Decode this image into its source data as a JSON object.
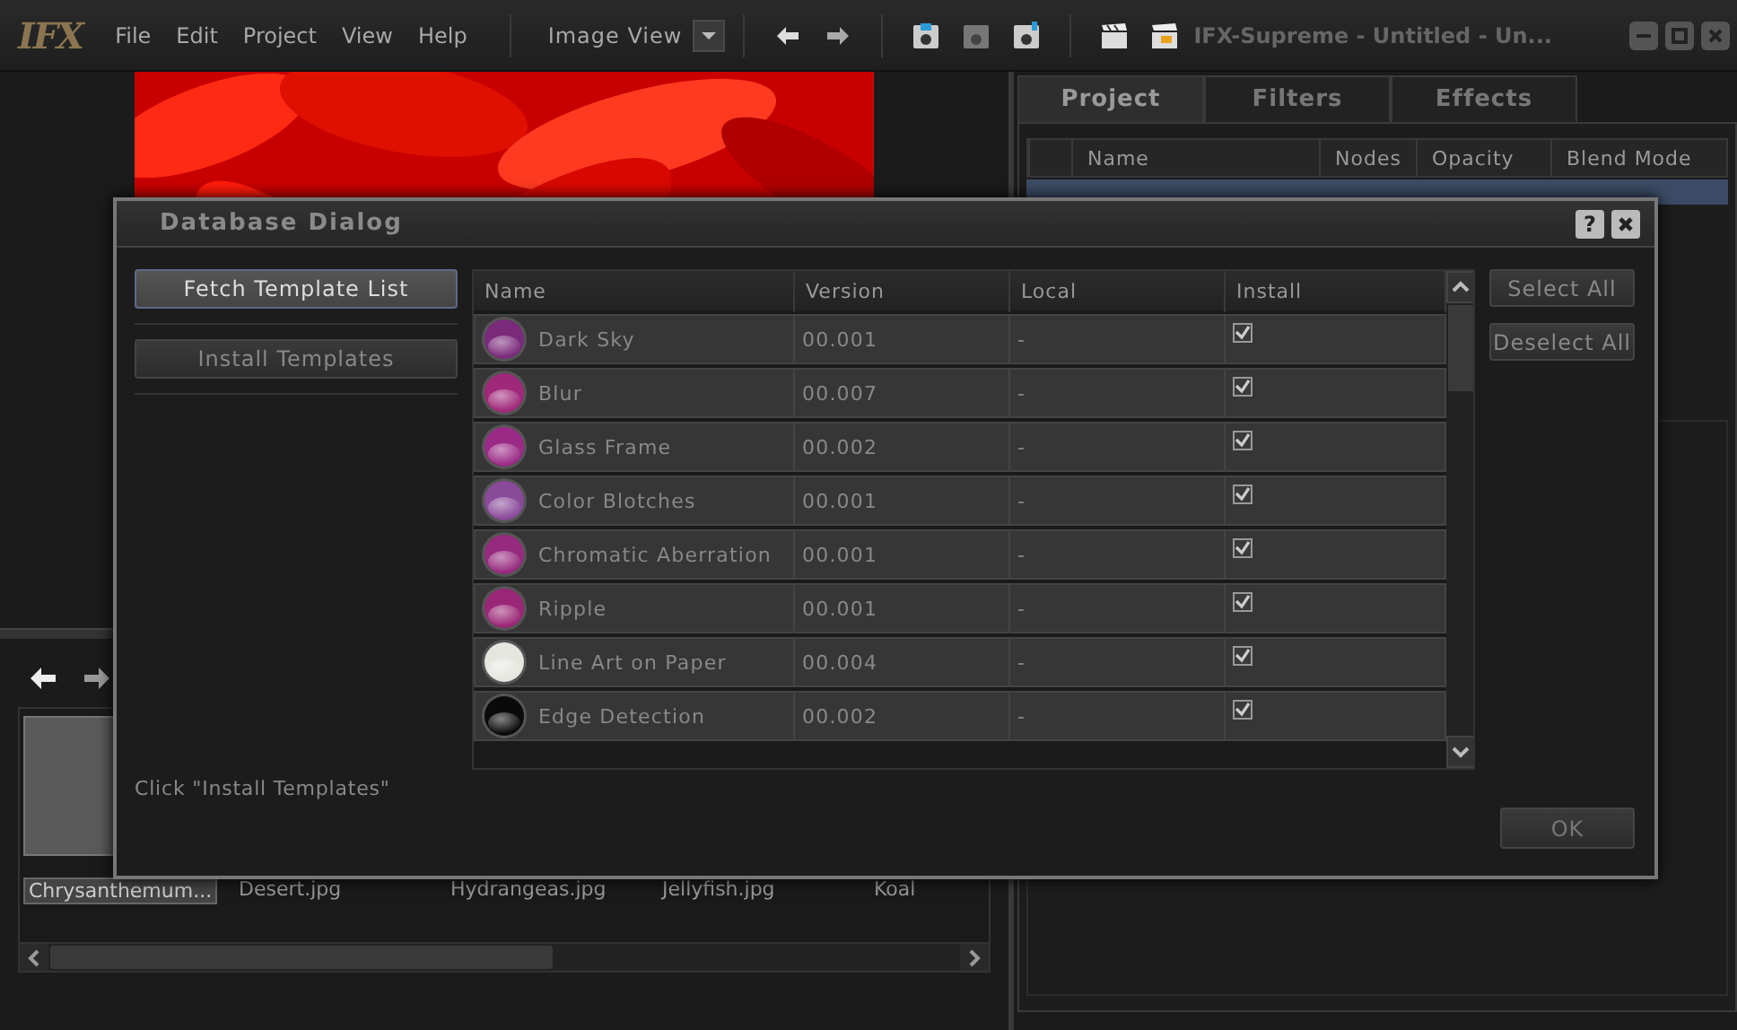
{
  "menubar": {
    "logo": "IFX",
    "menus": [
      "File",
      "Edit",
      "Project",
      "View",
      "Help"
    ],
    "view_select": "Image View",
    "title": "IFX-Supreme - Untitled - Un..."
  },
  "browser": {
    "thumbnails": [
      {
        "label": "Chrysanthemum...",
        "selected": true
      },
      {
        "label": "Desert.jpg",
        "selected": false
      },
      {
        "label": "Hydrangeas.jpg",
        "selected": false
      },
      {
        "label": "Jellyfish.jpg",
        "selected": false
      },
      {
        "label": "Koal",
        "selected": false
      }
    ]
  },
  "panel": {
    "tabs": [
      {
        "label": "Project",
        "selected": true
      },
      {
        "label": "Filters",
        "selected": false
      },
      {
        "label": "Effects",
        "selected": false
      }
    ],
    "columns": [
      "Name",
      "Nodes",
      "Opacity",
      "Blend Mode"
    ]
  },
  "dialog": {
    "title": "Database Dialog",
    "help": "?",
    "left_buttons": [
      {
        "label": "Fetch Template List",
        "focused": true
      },
      {
        "label": "Install Templates",
        "focused": false
      }
    ],
    "columns": [
      "Name",
      "Version",
      "Local",
      "Install"
    ],
    "rows": [
      {
        "name": "Dark Sky",
        "version": "00.001",
        "local": "-",
        "install": true,
        "color": "#7a2a7a"
      },
      {
        "name": "Blur",
        "version": "00.007",
        "local": "-",
        "install": true,
        "color": "#a0287a"
      },
      {
        "name": "Glass Frame",
        "version": "00.002",
        "local": "-",
        "install": true,
        "color": "#9a2a86"
      },
      {
        "name": "Color Blotches",
        "version": "00.001",
        "local": "-",
        "install": true,
        "color": "#8a4a9a"
      },
      {
        "name": "Chromatic Aberration",
        "version": "00.001",
        "local": "-",
        "install": true,
        "color": "#962a7e"
      },
      {
        "name": "Ripple",
        "version": "00.001",
        "local": "-",
        "install": true,
        "color": "#9a2676"
      },
      {
        "name": "Line Art on Paper",
        "version": "00.004",
        "local": "-",
        "install": true,
        "color": "#e6e6e0"
      },
      {
        "name": "Edge Detection",
        "version": "00.002",
        "local": "-",
        "install": true,
        "color": "#0a0a0a"
      }
    ],
    "side_buttons": [
      "Select All",
      "Deselect All"
    ],
    "status": "Click \"Install Templates\"",
    "ok": "OK"
  }
}
